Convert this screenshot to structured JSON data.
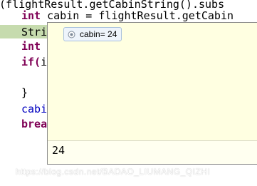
{
  "editor": {
    "lines": [
      {
        "id": "l0",
        "text": "r(flightResult.getCabinString().subs"
      },
      {
        "id": "l1",
        "kw": "int",
        "rest": " cabin = flightResult.getCabin"
      },
      {
        "id": "l2",
        "text": "Stri"
      },
      {
        "id": "l3",
        "kw": "int"
      },
      {
        "id": "l4",
        "kw": "if(",
        "rest": "i"
      },
      {
        "id": "l5",
        "text": ""
      },
      {
        "id": "l6",
        "text": "}"
      },
      {
        "id": "l7",
        "field": "cabi"
      },
      {
        "id": "l8",
        "kw": "brea"
      }
    ]
  },
  "hover": {
    "variable_label": "cabin= 24",
    "icon": "local-variable-icon",
    "value_text": "24"
  },
  "watermark": "https://blog.csdn.net/BADAO_LIUMANG_QIZHI"
}
